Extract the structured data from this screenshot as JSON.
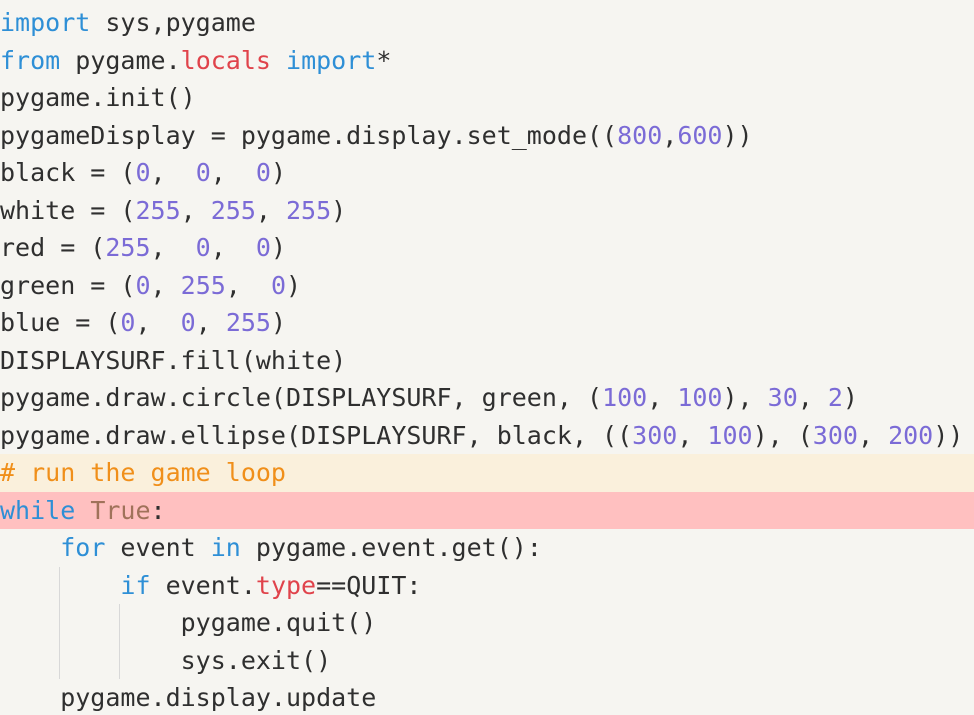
{
  "editor": {
    "lines": [
      [
        {
          "t": "import",
          "c": "kw"
        },
        {
          "t": " sys,pygame",
          "c": "txt"
        }
      ],
      [
        {
          "t": "from",
          "c": "kw"
        },
        {
          "t": " pygame.",
          "c": "txt"
        },
        {
          "t": "locals",
          "c": "prop"
        },
        {
          "t": " ",
          "c": "txt"
        },
        {
          "t": "import",
          "c": "kw"
        },
        {
          "t": "*",
          "c": "txt"
        }
      ],
      [
        {
          "t": "pygame.init()",
          "c": "txt"
        }
      ],
      [
        {
          "t": "pygameDisplay = pygame.display.set_mode((",
          "c": "txt"
        },
        {
          "t": "800",
          "c": "num"
        },
        {
          "t": ",",
          "c": "txt"
        },
        {
          "t": "600",
          "c": "num"
        },
        {
          "t": "))",
          "c": "txt"
        }
      ],
      [
        {
          "t": "black = (",
          "c": "txt"
        },
        {
          "t": "0",
          "c": "num"
        },
        {
          "t": ",  ",
          "c": "txt"
        },
        {
          "t": "0",
          "c": "num"
        },
        {
          "t": ",  ",
          "c": "txt"
        },
        {
          "t": "0",
          "c": "num"
        },
        {
          "t": ")",
          "c": "txt"
        }
      ],
      [
        {
          "t": "white = (",
          "c": "txt"
        },
        {
          "t": "255",
          "c": "num"
        },
        {
          "t": ", ",
          "c": "txt"
        },
        {
          "t": "255",
          "c": "num"
        },
        {
          "t": ", ",
          "c": "txt"
        },
        {
          "t": "255",
          "c": "num"
        },
        {
          "t": ")",
          "c": "txt"
        }
      ],
      [
        {
          "t": "red = (",
          "c": "txt"
        },
        {
          "t": "255",
          "c": "num"
        },
        {
          "t": ",  ",
          "c": "txt"
        },
        {
          "t": "0",
          "c": "num"
        },
        {
          "t": ",  ",
          "c": "txt"
        },
        {
          "t": "0",
          "c": "num"
        },
        {
          "t": ")",
          "c": "txt"
        }
      ],
      [
        {
          "t": "green = (",
          "c": "txt"
        },
        {
          "t": "0",
          "c": "num"
        },
        {
          "t": ", ",
          "c": "txt"
        },
        {
          "t": "255",
          "c": "num"
        },
        {
          "t": ",  ",
          "c": "txt"
        },
        {
          "t": "0",
          "c": "num"
        },
        {
          "t": ")",
          "c": "txt"
        }
      ],
      [
        {
          "t": "blue = (",
          "c": "txt"
        },
        {
          "t": "0",
          "c": "num"
        },
        {
          "t": ",  ",
          "c": "txt"
        },
        {
          "t": "0",
          "c": "num"
        },
        {
          "t": ", ",
          "c": "txt"
        },
        {
          "t": "255",
          "c": "num"
        },
        {
          "t": ")",
          "c": "txt"
        }
      ],
      [
        {
          "t": "DISPLAYSURF.fill(white)",
          "c": "txt"
        }
      ],
      [
        {
          "t": "pygame.draw.circle(DISPLAYSURF, green, (",
          "c": "txt"
        },
        {
          "t": "100",
          "c": "num"
        },
        {
          "t": ", ",
          "c": "txt"
        },
        {
          "t": "100",
          "c": "num"
        },
        {
          "t": "), ",
          "c": "txt"
        },
        {
          "t": "30",
          "c": "num"
        },
        {
          "t": ", ",
          "c": "txt"
        },
        {
          "t": "2",
          "c": "num"
        },
        {
          "t": ")",
          "c": "txt"
        }
      ],
      [
        {
          "t": "pygame.draw.ellipse(DISPLAYSURF, black, ((",
          "c": "txt"
        },
        {
          "t": "300",
          "c": "num"
        },
        {
          "t": ", ",
          "c": "txt"
        },
        {
          "t": "100",
          "c": "num"
        },
        {
          "t": "), (",
          "c": "txt"
        },
        {
          "t": "300",
          "c": "num"
        },
        {
          "t": ", ",
          "c": "txt"
        },
        {
          "t": "200",
          "c": "num"
        },
        {
          "t": "))",
          "c": "txt"
        }
      ],
      [
        {
          "t": "# run the game loop",
          "c": "cmt"
        }
      ],
      [
        {
          "t": "while",
          "c": "kw"
        },
        {
          "t": " ",
          "c": "txt"
        },
        {
          "t": "True",
          "c": "bool"
        },
        {
          "t": ":",
          "c": "txt"
        }
      ],
      [
        {
          "t": "    ",
          "c": "txt"
        },
        {
          "t": "for",
          "c": "kw"
        },
        {
          "t": " event ",
          "c": "txt"
        },
        {
          "t": "in",
          "c": "kw"
        },
        {
          "t": " pygame.event.get():",
          "c": "txt"
        }
      ],
      [
        {
          "t": "        ",
          "c": "txt"
        },
        {
          "t": "if",
          "c": "kw"
        },
        {
          "t": " event.",
          "c": "txt"
        },
        {
          "t": "type",
          "c": "prop"
        },
        {
          "t": "==QUIT:",
          "c": "txt"
        }
      ],
      [
        {
          "t": "            pygame.quit()",
          "c": "txt"
        }
      ],
      [
        {
          "t": "            sys.exit()",
          "c": "txt"
        }
      ],
      [
        {
          "t": "    pygame.display.update",
          "c": "txt"
        }
      ]
    ],
    "highlights": {
      "comment_line": 12,
      "error_line": 13
    },
    "colors": {
      "background": "#f6f5f1",
      "keyword": "#2e8fd6",
      "number": "#7b6bd6",
      "property": "#e0434b",
      "comment": "#f08f1a",
      "boolean": "#a0725a",
      "comment_line_bg": "#faf0dc",
      "error_line_bg": "#ffc0c0"
    }
  }
}
